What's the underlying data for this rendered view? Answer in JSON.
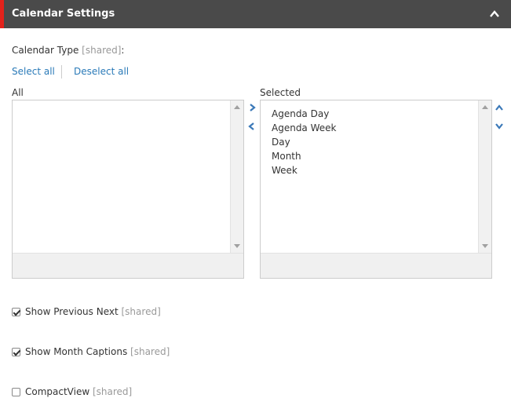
{
  "header": {
    "title": "Calendar Settings"
  },
  "field": {
    "label": "Calendar Type",
    "shared_tag": "[shared]",
    "colon": ":"
  },
  "actions": {
    "select_all": "Select all",
    "deselect_all": "Deselect all"
  },
  "lists": {
    "all_label": "All",
    "selected_label": "Selected",
    "all_items": [],
    "selected_items": [
      "Agenda Day",
      "Agenda Week",
      "Day",
      "Month",
      "Week"
    ]
  },
  "checkboxes": [
    {
      "label": "Show Previous Next",
      "shared_tag": "[shared]",
      "checked": true
    },
    {
      "label": "Show Month Captions",
      "shared_tag": "[shared]",
      "checked": true
    },
    {
      "label": "CompactView",
      "shared_tag": "[shared]",
      "checked": false
    }
  ],
  "colors": {
    "accent": "#e3221b",
    "header_bg": "#4a4a4a",
    "link": "#2a7ab8",
    "arrow": "#3a78b8"
  },
  "icons": {
    "collapse": "chevron-up-icon",
    "move_right": "chevron-right-icon",
    "move_left": "chevron-left-icon",
    "move_up": "chevron-up-icon",
    "move_down": "chevron-down-icon"
  }
}
